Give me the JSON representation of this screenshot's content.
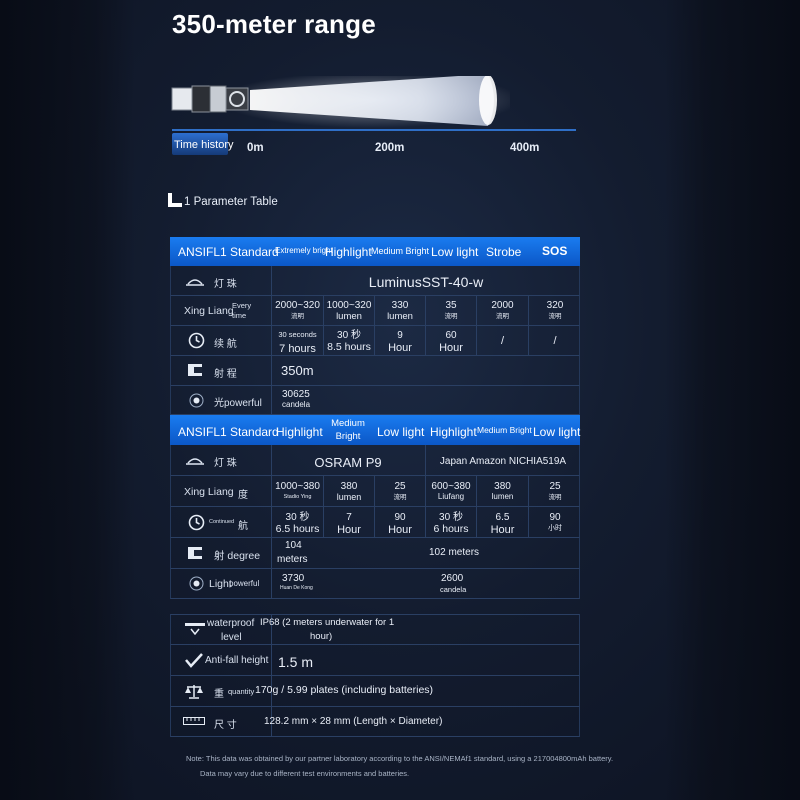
{
  "title": "350-meter range",
  "beam": {
    "time_history": "Time history",
    "ticks": [
      "0m",
      "200m",
      "400m"
    ]
  },
  "param_heading": "1 Parameter Table",
  "table1": {
    "headers": [
      "ANSIFL1 Standard",
      "Extremely bright",
      "Highlight",
      "Medium Bright",
      "Low light",
      "Strobe",
      "SOS"
    ],
    "lamp_label": "灯  珠",
    "lamp_value": "LuminusSST-40-w",
    "flux_label_a": "Xing Liang",
    "flux_label_b": "Every time",
    "flux": [
      {
        "top": "2000~320",
        "bottom": "流明"
      },
      {
        "top": "1000~320",
        "bottom": "lumen"
      },
      {
        "top": "330",
        "bottom": "lumen"
      },
      {
        "top": "35",
        "bottom": "流明"
      },
      {
        "top": "2000",
        "bottom": "流明"
      },
      {
        "top": "320",
        "bottom": "流明"
      }
    ],
    "runtime_label": "续  航",
    "runtime": [
      {
        "top": "30 seconds",
        "bottom": "7 hours"
      },
      {
        "top": "30 秒",
        "bottom": "8.5 hours"
      },
      {
        "top": "9",
        "bottom": "Hour"
      },
      {
        "top": "60",
        "bottom": "Hour"
      },
      {
        "top": "/",
        "bottom": ""
      },
      {
        "top": "/",
        "bottom": ""
      }
    ],
    "range_label": "射  程",
    "range_value": "350m",
    "intensity_label": "光powerful",
    "intensity_value": "30625",
    "intensity_unit": "candela"
  },
  "table2": {
    "headers": [
      "ANSIFL1 Standard",
      "Highlight",
      "Medium Bright",
      "Low light",
      "Highlight",
      "Medium Bright",
      "Low light"
    ],
    "lamp_label": "灯  珠",
    "lamp_a": "OSRAM P9",
    "lamp_b": "Japan Amazon NICHIA519A",
    "flux_label_a": "Xing Liang",
    "flux_label_b": "度",
    "flux": [
      {
        "top": "1000~380",
        "bottom": "Stadio Ying"
      },
      {
        "top": "380",
        "bottom": "lumen"
      },
      {
        "top": "25",
        "bottom": "流明"
      },
      {
        "top": "600~380",
        "bottom": "Liufang"
      },
      {
        "top": "380",
        "bottom": "lumen"
      },
      {
        "top": "25",
        "bottom": "流明"
      }
    ],
    "runtime_label_a": "Continued",
    "runtime_label_b": "航",
    "runtime": [
      {
        "top": "30 秒",
        "bottom": "6.5 hours"
      },
      {
        "top": "7",
        "bottom": "Hour"
      },
      {
        "top": "90",
        "bottom": "Hour"
      },
      {
        "top": "30 秒",
        "bottom": "6 hours"
      },
      {
        "top": "6.5",
        "bottom": "Hour"
      },
      {
        "top": "90",
        "bottom": "小时"
      }
    ],
    "range_label": "射 degree",
    "range_a_top": "104",
    "range_a_bottom": "meters",
    "range_b": "102 meters",
    "intensity_label_a": "Light",
    "intensity_label_b": "powerful",
    "intensity_a": "3730",
    "intensity_a_unit": "Huan De Kong",
    "intensity_b": "2600",
    "intensity_b_unit": "candela"
  },
  "table3": {
    "waterproof_label_a": "waterproof",
    "waterproof_label_b": "level",
    "waterproof_value_a": "IP68 (2 meters underwater for 1",
    "waterproof_value_b": "hour)",
    "antifall_label": "Anti-fall height",
    "antifall_value": "1.5 m",
    "weight_label_a": "重",
    "weight_label_b": "quantity",
    "weight_value": "170g / 5.99 plates (including batteries)",
    "size_label": "尺  寸",
    "size_value": "128.2 mm × 28 mm (Length × Diameter)"
  },
  "note_line1": "Note: This data was obtained by our partner laboratory according to the ANSI/NEMAf1 standard, using a 217004800mAh battery.",
  "note_line2": "Data may vary due to different test environments and batteries."
}
